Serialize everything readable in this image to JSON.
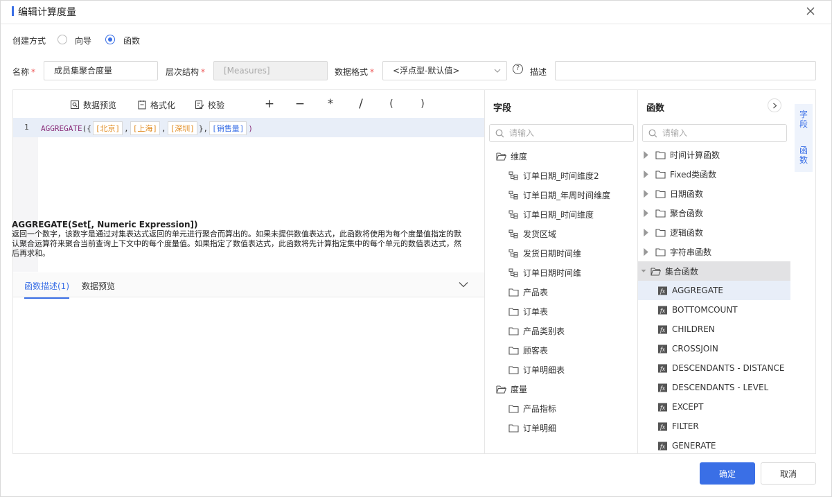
{
  "dialog": {
    "title": "编辑计算度量"
  },
  "form": {
    "create_mode_label": "创建方式",
    "mode_options": [
      {
        "label": "向导",
        "selected": false
      },
      {
        "label": "函数",
        "selected": true
      }
    ],
    "name_label": "名称",
    "name_value": "成员集聚合度量",
    "hierarchy_label": "层次结构",
    "hierarchy_value": "[Measures]",
    "format_label": "数据格式",
    "format_value": "<浮点型-默认值>",
    "desc_label": "描述",
    "desc_value": "",
    "required_mark": "*",
    "help_icon": "?"
  },
  "toolbar": {
    "preview_label": "数据预览",
    "format_label": "格式化",
    "validate_label": "校验",
    "operators": [
      "+",
      "−",
      "*",
      "/",
      "(",
      ")"
    ]
  },
  "editor": {
    "line_number": "1",
    "fn_name": "AGGREGATE",
    "open": "({",
    "members": [
      "[北京]",
      "[上海]",
      "[深圳]"
    ],
    "sep": ",",
    "close_set": "},",
    "measure": "[销售量]",
    "close": ")"
  },
  "description": {
    "tabs": [
      {
        "label": "函数描述(1)",
        "active": true
      },
      {
        "label": "数据预览",
        "active": false
      }
    ],
    "title": "AGGREGATE(Set[, Numeric Expression])",
    "body": "返回一个数字，该数字是通过对集表达式返回的单元进行聚合而算出的。如果未提供数值表达式，此函数将使用为每个度量值指定的默认聚合运算符来聚合当前查询上下文中的每个度量值。如果指定了数值表达式，此函数将先计算指定集中的每个单元的数值表达式，然后再求和。"
  },
  "fields_pane": {
    "title": "字段",
    "search_placeholder": "请输入",
    "groups": [
      {
        "label": "维度",
        "items": [
          {
            "label": "订单日期_时间维度2",
            "kind": "hierarchy"
          },
          {
            "label": "订单日期_年周时间维度",
            "kind": "hierarchy"
          },
          {
            "label": "订单日期_时间维度",
            "kind": "hierarchy"
          },
          {
            "label": "发货区域",
            "kind": "hierarchy"
          },
          {
            "label": "发货日期时间维",
            "kind": "hierarchy"
          },
          {
            "label": "订单日期时间维",
            "kind": "hierarchy"
          },
          {
            "label": "产品表",
            "kind": "folder"
          },
          {
            "label": "订单表",
            "kind": "folder"
          },
          {
            "label": "产品类别表",
            "kind": "folder"
          },
          {
            "label": "顾客表",
            "kind": "folder"
          },
          {
            "label": "订单明细表",
            "kind": "folder"
          }
        ]
      },
      {
        "label": "度量",
        "items": [
          {
            "label": "产品指标",
            "kind": "folder"
          },
          {
            "label": "订单明细",
            "kind": "folder"
          }
        ]
      }
    ]
  },
  "functions_pane": {
    "title": "函数",
    "search_placeholder": "请输入",
    "categories": [
      {
        "label": "时间计算函数",
        "expanded": false
      },
      {
        "label": "Fixed类函数",
        "expanded": false
      },
      {
        "label": "日期函数",
        "expanded": false
      },
      {
        "label": "聚合函数",
        "expanded": false
      },
      {
        "label": "逻辑函数",
        "expanded": false
      },
      {
        "label": "字符串函数",
        "expanded": false
      },
      {
        "label": "集合函数",
        "expanded": true
      }
    ],
    "set_functions": [
      {
        "label": "AGGREGATE",
        "selected": true
      },
      {
        "label": "BOTTOMCOUNT",
        "selected": false
      },
      {
        "label": "CHILDREN",
        "selected": false
      },
      {
        "label": "CROSSJOIN",
        "selected": false
      },
      {
        "label": "DESCENDANTS - DISTANCE",
        "selected": false
      },
      {
        "label": "DESCENDANTS - LEVEL",
        "selected": false
      },
      {
        "label": "EXCEPT",
        "selected": false
      },
      {
        "label": "FILTER",
        "selected": false
      },
      {
        "label": "GENERATE",
        "selected": false
      }
    ],
    "fx_label": "fx"
  },
  "side_tabs": [
    "字段",
    "函数"
  ],
  "footer": {
    "ok_label": "确定",
    "cancel_label": "取消"
  },
  "colors": {
    "accent": "#3a6fe6",
    "dimension_member": "#e08a1e",
    "function_name": "#8a2e7a"
  }
}
